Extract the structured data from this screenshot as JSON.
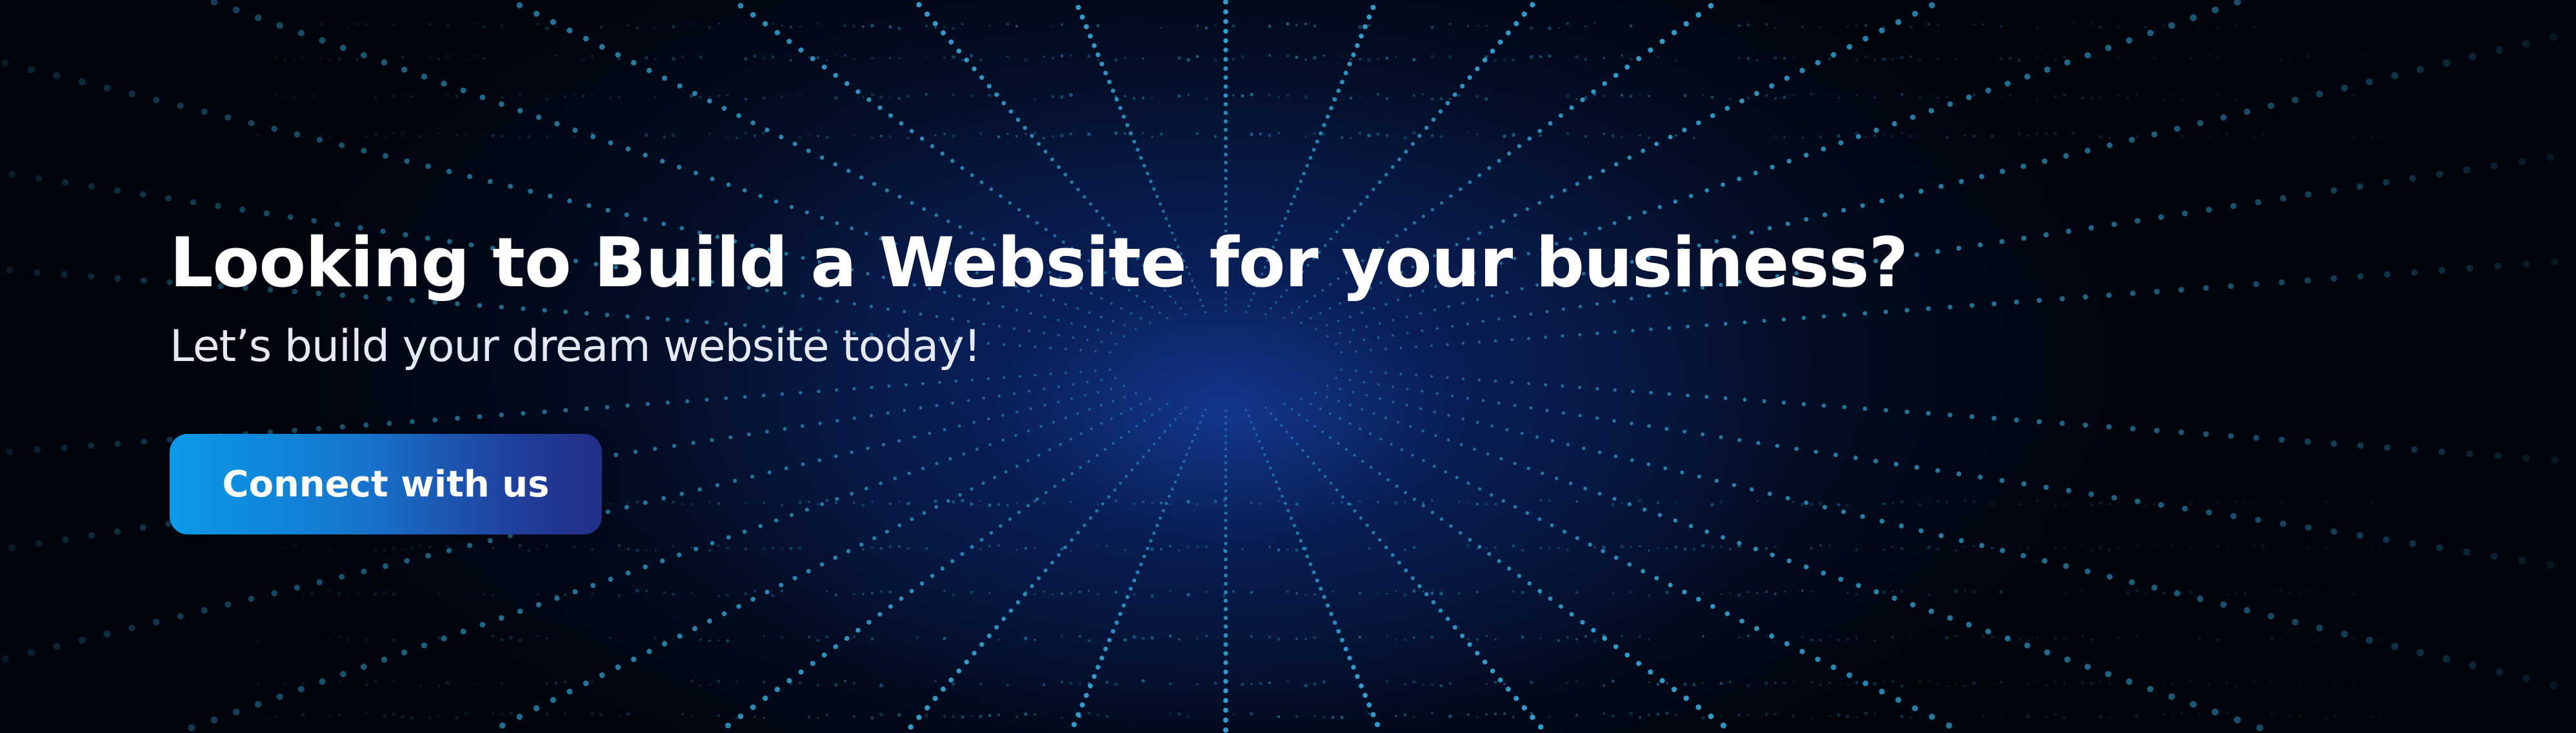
{
  "banner": {
    "headline": "Looking to Build a Website for your business?",
    "subheadline": "Let’s build your dream website today!",
    "cta_label": "Connect with us"
  },
  "colors": {
    "background": "#020a1c",
    "glow": "#0a1f55",
    "dot": "#3ab6e8",
    "button_start": "#0a9be8",
    "button_end": "#232f86",
    "text": "#ffffff"
  }
}
